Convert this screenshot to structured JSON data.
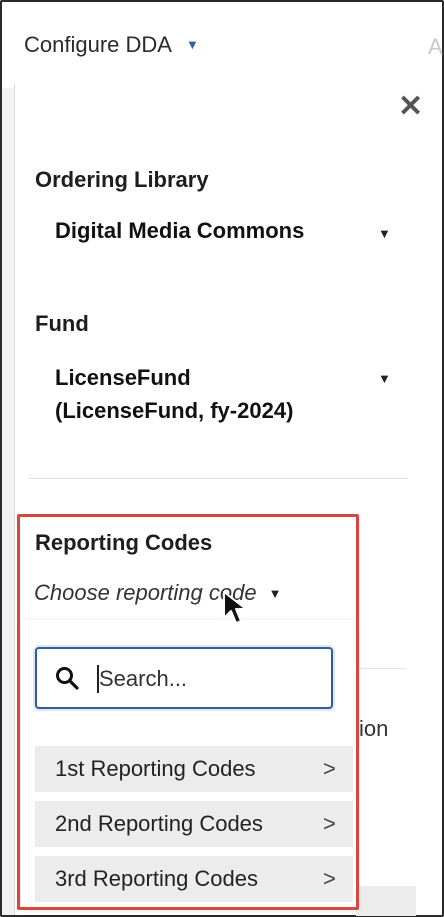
{
  "header": {
    "menu_label": "Configure DDA",
    "menu_caret": "▼",
    "truncated_next": "A"
  },
  "panel": {
    "close_glyph": "✕",
    "ordering_library": {
      "label": "Ordering Library",
      "value": "Digital Media Commons",
      "caret": "▼"
    },
    "fund": {
      "label": "Fund",
      "value_line1": "LicenseFund",
      "value_line2": "(LicenseFund, fy-2024)",
      "caret": "▼"
    },
    "reporting_codes": {
      "label": "Reporting Codes",
      "placeholder": "Choose reporting code",
      "caret": "▼"
    },
    "background_fragment": "ion"
  },
  "dropdown": {
    "search_placeholder": "Search...",
    "options": [
      {
        "label": "1st Reporting Codes",
        "chevron": ">"
      },
      {
        "label": "2nd Reporting Codes",
        "chevron": ">"
      },
      {
        "label": "3rd Reporting Codes",
        "chevron": ">"
      }
    ]
  },
  "colors": {
    "highlight": "#d9453f",
    "accent": "#2e5e9e",
    "option_bg": "#ececec"
  }
}
